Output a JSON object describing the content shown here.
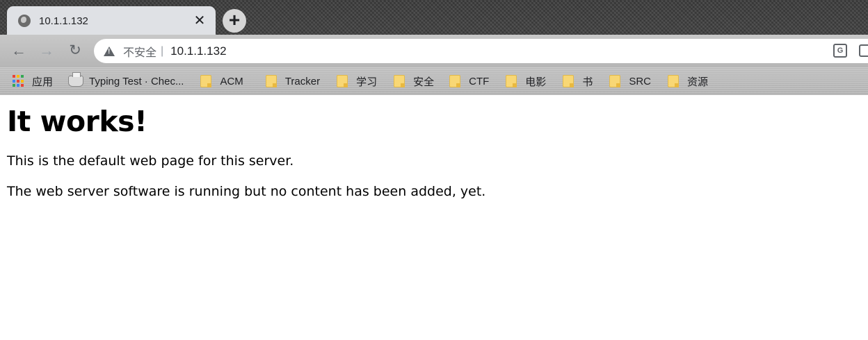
{
  "tab": {
    "title": "10.1.1.132",
    "close": "✕"
  },
  "new_tab_label": "+",
  "nav": {
    "back": "←",
    "forward": "→",
    "reload": "↻"
  },
  "omnibox": {
    "security_label": "不安全",
    "separator": "|",
    "url": "10.1.1.132"
  },
  "bookmarks": [
    {
      "label": "应用",
      "icon": "apps-icon"
    },
    {
      "label": "Typing Test · Chec...",
      "icon": "typewriter-icon"
    },
    {
      "label": "ACM",
      "icon": "folder-icon"
    },
    {
      "label": "Tracker",
      "icon": "folder-icon"
    },
    {
      "label": "学习",
      "icon": "folder-icon"
    },
    {
      "label": "安全",
      "icon": "folder-icon"
    },
    {
      "label": "CTF",
      "icon": "folder-icon"
    },
    {
      "label": "电影",
      "icon": "folder-icon"
    },
    {
      "label": "书",
      "icon": "folder-icon"
    },
    {
      "label": "SRC",
      "icon": "folder-icon"
    },
    {
      "label": "资源",
      "icon": "folder-icon"
    }
  ],
  "content": {
    "heading": "It works!",
    "line1": "This is the default web page for this server.",
    "line2": "The web server software is running but no content has been added, yet."
  },
  "colors": {
    "apps": [
      "#ea4335",
      "#fbbc04",
      "#34a853",
      "#4285f4",
      "#ea4335",
      "#fbbc04",
      "#34a853",
      "#4285f4",
      "#ea4335"
    ]
  }
}
